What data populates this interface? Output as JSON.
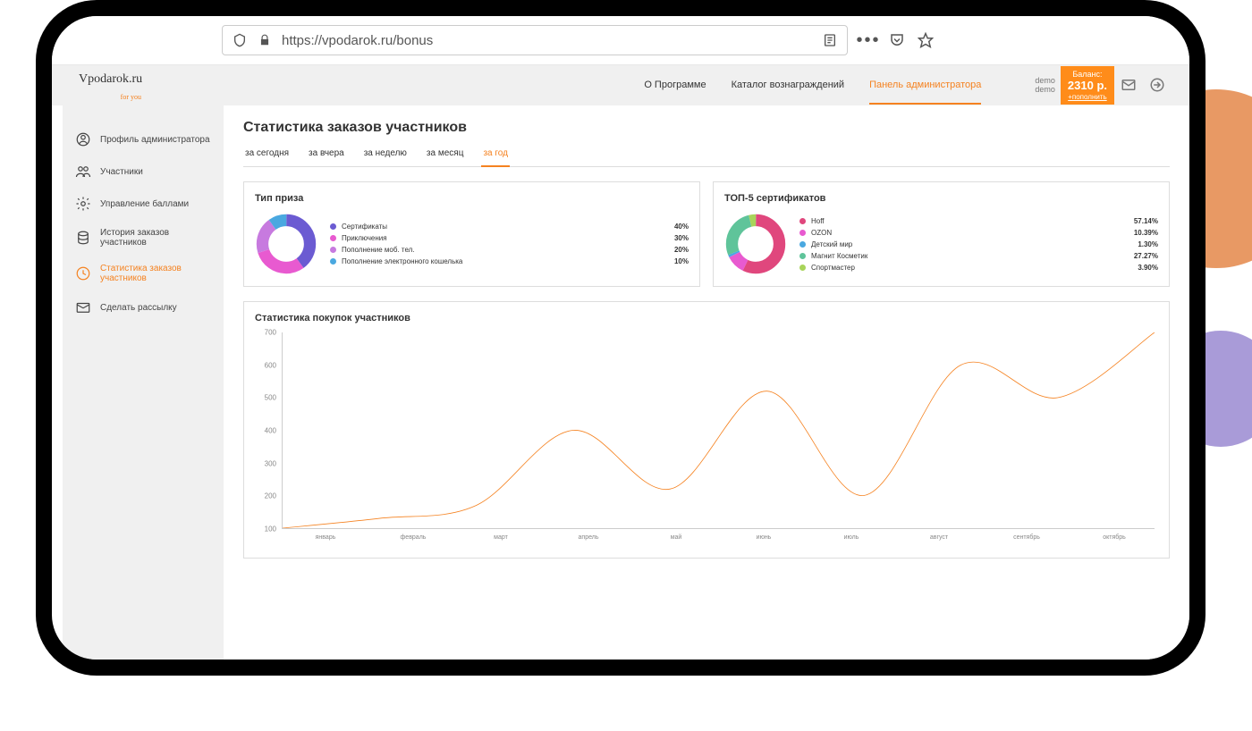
{
  "browser": {
    "url": "https://vpodarok.ru/bonus"
  },
  "header": {
    "nav": [
      {
        "label": "О Программе",
        "active": false
      },
      {
        "label": "Каталог вознаграждений",
        "active": false
      },
      {
        "label": "Панель администратора",
        "active": true
      }
    ],
    "user_line1": "demo",
    "user_line2": "demo",
    "balance_label": "Баланс:",
    "balance_amount": "2310 р.",
    "balance_topup": "+пополнить"
  },
  "sidebar": {
    "items": [
      {
        "label": "Профиль администратора",
        "icon": "user-circle-icon"
      },
      {
        "label": "Участники",
        "icon": "users-icon"
      },
      {
        "label": "Управление баллами",
        "icon": "gear-icon"
      },
      {
        "label": "История заказов участников",
        "icon": "history-icon"
      },
      {
        "label": "Статистика заказов участников",
        "icon": "clock-icon",
        "active": true
      },
      {
        "label": "Сделать рассылку",
        "icon": "mail-icon"
      }
    ]
  },
  "page_title": "Статистика заказов участников",
  "tabs": [
    {
      "label": "за сегодня"
    },
    {
      "label": "за вчера"
    },
    {
      "label": "за неделю"
    },
    {
      "label": "за месяц"
    },
    {
      "label": "за год",
      "active": true
    }
  ],
  "prize_card": {
    "title": "Тип приза"
  },
  "top5_card": {
    "title": "ТОП-5 сертификатов"
  },
  "stats_card": {
    "title": "Статистика покупок участников"
  },
  "chart_data": [
    {
      "type": "pie",
      "title": "Тип приза",
      "series": [
        {
          "name": "Сертификаты",
          "value": 40,
          "label": "40%",
          "color": "#6b5bd2"
        },
        {
          "name": "Приключения",
          "value": 30,
          "label": "30%",
          "color": "#e85ad0"
        },
        {
          "name": "Пополнение моб. тел.",
          "value": 20,
          "label": "20%",
          "color": "#c77adf"
        },
        {
          "name": "Пополнение электронного кошелька",
          "value": 10,
          "label": "10%",
          "color": "#4aa8e0"
        }
      ]
    },
    {
      "type": "pie",
      "title": "ТОП-5 сертификатов",
      "series": [
        {
          "name": "Hoff",
          "value": 57.14,
          "label": "57.14%",
          "color": "#e0477d"
        },
        {
          "name": "OZON",
          "value": 10.39,
          "label": "10.39%",
          "color": "#e85ad0"
        },
        {
          "name": "Детский мир",
          "value": 1.3,
          "label": "1.30%",
          "color": "#4aa8e0"
        },
        {
          "name": "Магнит Косметик",
          "value": 27.27,
          "label": "27.27%",
          "color": "#5fc49a"
        },
        {
          "name": "Спортмастер",
          "value": 3.9,
          "label": "3.90%",
          "color": "#a8d45a"
        }
      ]
    },
    {
      "type": "line",
      "title": "Статистика покупок участников",
      "x": [
        "январь",
        "февраль",
        "март",
        "апрель",
        "май",
        "июнь",
        "июль",
        "август",
        "сентябрь",
        "октябрь"
      ],
      "values": [
        100,
        130,
        170,
        400,
        220,
        520,
        200,
        600,
        500,
        700
      ],
      "ylim": [
        100,
        700
      ],
      "y_ticks": [
        100,
        200,
        300,
        400,
        500,
        600,
        700
      ],
      "line_color": "#f58220"
    }
  ]
}
